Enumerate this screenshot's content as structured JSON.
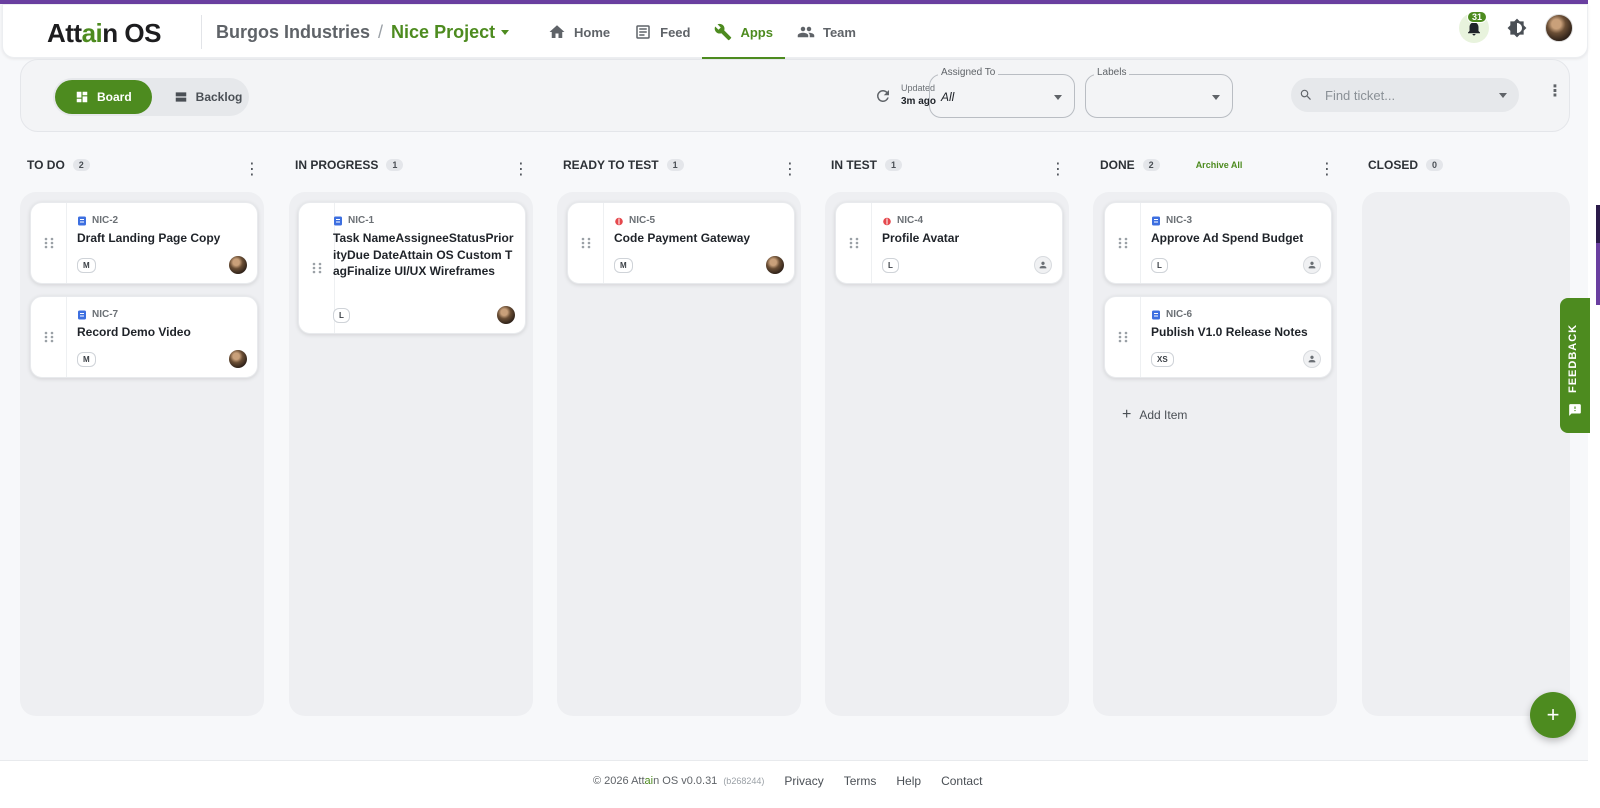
{
  "colors": {
    "accent": "#4d8b1f",
    "brand_stripe": "#6a3fa0"
  },
  "header": {
    "logo_prefix": "Att",
    "logo_accent": "ai",
    "logo_suffix": "n OS",
    "org": "Burgos Industries",
    "separator": "/",
    "project": "Nice Project",
    "nav": [
      {
        "label": "Home",
        "icon": "home-icon"
      },
      {
        "label": "Feed",
        "icon": "feed-icon"
      },
      {
        "label": "Apps",
        "icon": "wrench-icon",
        "active": true
      },
      {
        "label": "Team",
        "icon": "team-icon"
      }
    ],
    "notifications_count": "31"
  },
  "toolbar": {
    "view_board": "Board",
    "view_backlog": "Backlog",
    "updated_label": "Updated",
    "updated_ago": "3m ago",
    "assigned_label": "Assigned To",
    "assigned_value": "All",
    "labels_label": "Labels",
    "labels_value": "",
    "search_placeholder": "Find ticket..."
  },
  "columns": [
    {
      "name": "TO DO",
      "count": "2",
      "cards": [
        {
          "key": "NIC-2",
          "type": "task",
          "title": "Draft Landing Page Copy",
          "size": "M",
          "assignee": "photo"
        },
        {
          "key": "NIC-7",
          "type": "task",
          "title": "Record Demo Video",
          "size": "M",
          "assignee": "photo"
        }
      ]
    },
    {
      "name": "IN PROGRESS",
      "count": "1",
      "cards": [
        {
          "key": "NIC-1",
          "type": "task",
          "title": "Task NameAssigneeStatusPriorityDue DateAttain OS Custom TagFinalize UI/UX Wireframes",
          "size": "L",
          "assignee": "photo"
        }
      ]
    },
    {
      "name": "READY TO TEST",
      "count": "1",
      "cards": [
        {
          "key": "NIC-5",
          "type": "bug",
          "title": "Code Payment Gateway",
          "size": "M",
          "assignee": "photo"
        }
      ]
    },
    {
      "name": "IN TEST",
      "count": "1",
      "cards": [
        {
          "key": "NIC-4",
          "type": "bug",
          "title": "Profile Avatar",
          "size": "L",
          "assignee": "none"
        }
      ]
    },
    {
      "name": "DONE",
      "count": "2",
      "archive_all": "Archive All",
      "add_item": "Add Item",
      "cards": [
        {
          "key": "NIC-3",
          "type": "task",
          "title": "Approve Ad Spend Budget",
          "size": "L",
          "assignee": "none"
        },
        {
          "key": "NIC-6",
          "type": "task",
          "title": "Publish V1.0 Release Notes",
          "size": "XS",
          "assignee": "none"
        }
      ]
    },
    {
      "name": "CLOSED",
      "count": "0",
      "cards": []
    }
  ],
  "feedback_label": "FEEDBACK",
  "footer": {
    "copy_prefix": "© 2026 Att",
    "copy_accent": "ai",
    "copy_suffix": "n OS v0.0.31",
    "build": "(b268244)",
    "links": [
      "Privacy",
      "Terms",
      "Help",
      "Contact"
    ]
  }
}
